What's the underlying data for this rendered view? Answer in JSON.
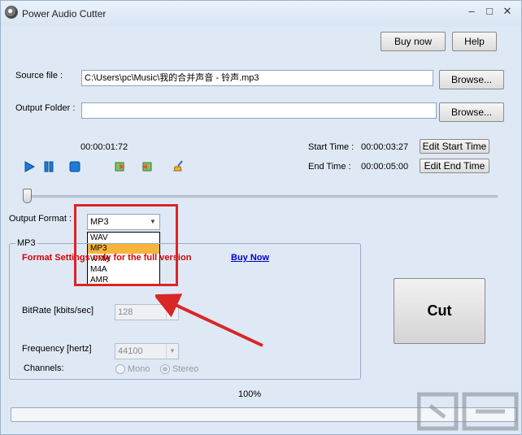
{
  "window": {
    "title": "Power Audio Cutter",
    "controls": {
      "minimize": "–",
      "maximize": "□",
      "close": "✕"
    }
  },
  "header_buttons": {
    "buy_now": "Buy now",
    "help": "Help"
  },
  "source": {
    "label": "Source file :",
    "value": "C:\\Users\\pc\\Music\\我的合并声音 - 铃声.mp3",
    "browse": "Browse..."
  },
  "output_folder": {
    "label": "Output Folder :",
    "value": "",
    "browse": "Browse..."
  },
  "playback": {
    "current_time": "00:00:01:72",
    "start_label": "Start Time :",
    "start_value": "00:00:03:27",
    "end_label": "End Time :",
    "end_value": "00:00:05:00",
    "edit_start": "Edit Start Time",
    "edit_end": "Edit End Time",
    "icons": [
      "play-icon",
      "pause-icon",
      "stop-icon",
      "set-start-icon",
      "set-end-icon",
      "clean-icon"
    ],
    "slider_position": 0.0
  },
  "format": {
    "label": "Output Format :",
    "selected": "MP3",
    "options": [
      "WAV",
      "MP3",
      "WMA",
      "M4A",
      "AMR"
    ],
    "highlighted_option": "MP3"
  },
  "group": {
    "title": "MP3",
    "notice": "Format Settings only for the full version",
    "buy_link": "Buy Now",
    "bitrate_label": "BitRate [kbits/sec]",
    "bitrate_value": "128",
    "frequency_label": "Frequency [hertz]",
    "frequency_value": "44100",
    "channels_label": "Channels:",
    "mono": "Mono",
    "stereo": "Stereo",
    "selected_channel": "Stereo"
  },
  "cut_button": "Cut",
  "progress": {
    "text": "100%",
    "value": 1.0
  },
  "colors": {
    "accent_red": "#d92626",
    "link_blue": "#0000c8",
    "selected_item": "#f6b53a",
    "window_bg": "#dfe9f5"
  }
}
